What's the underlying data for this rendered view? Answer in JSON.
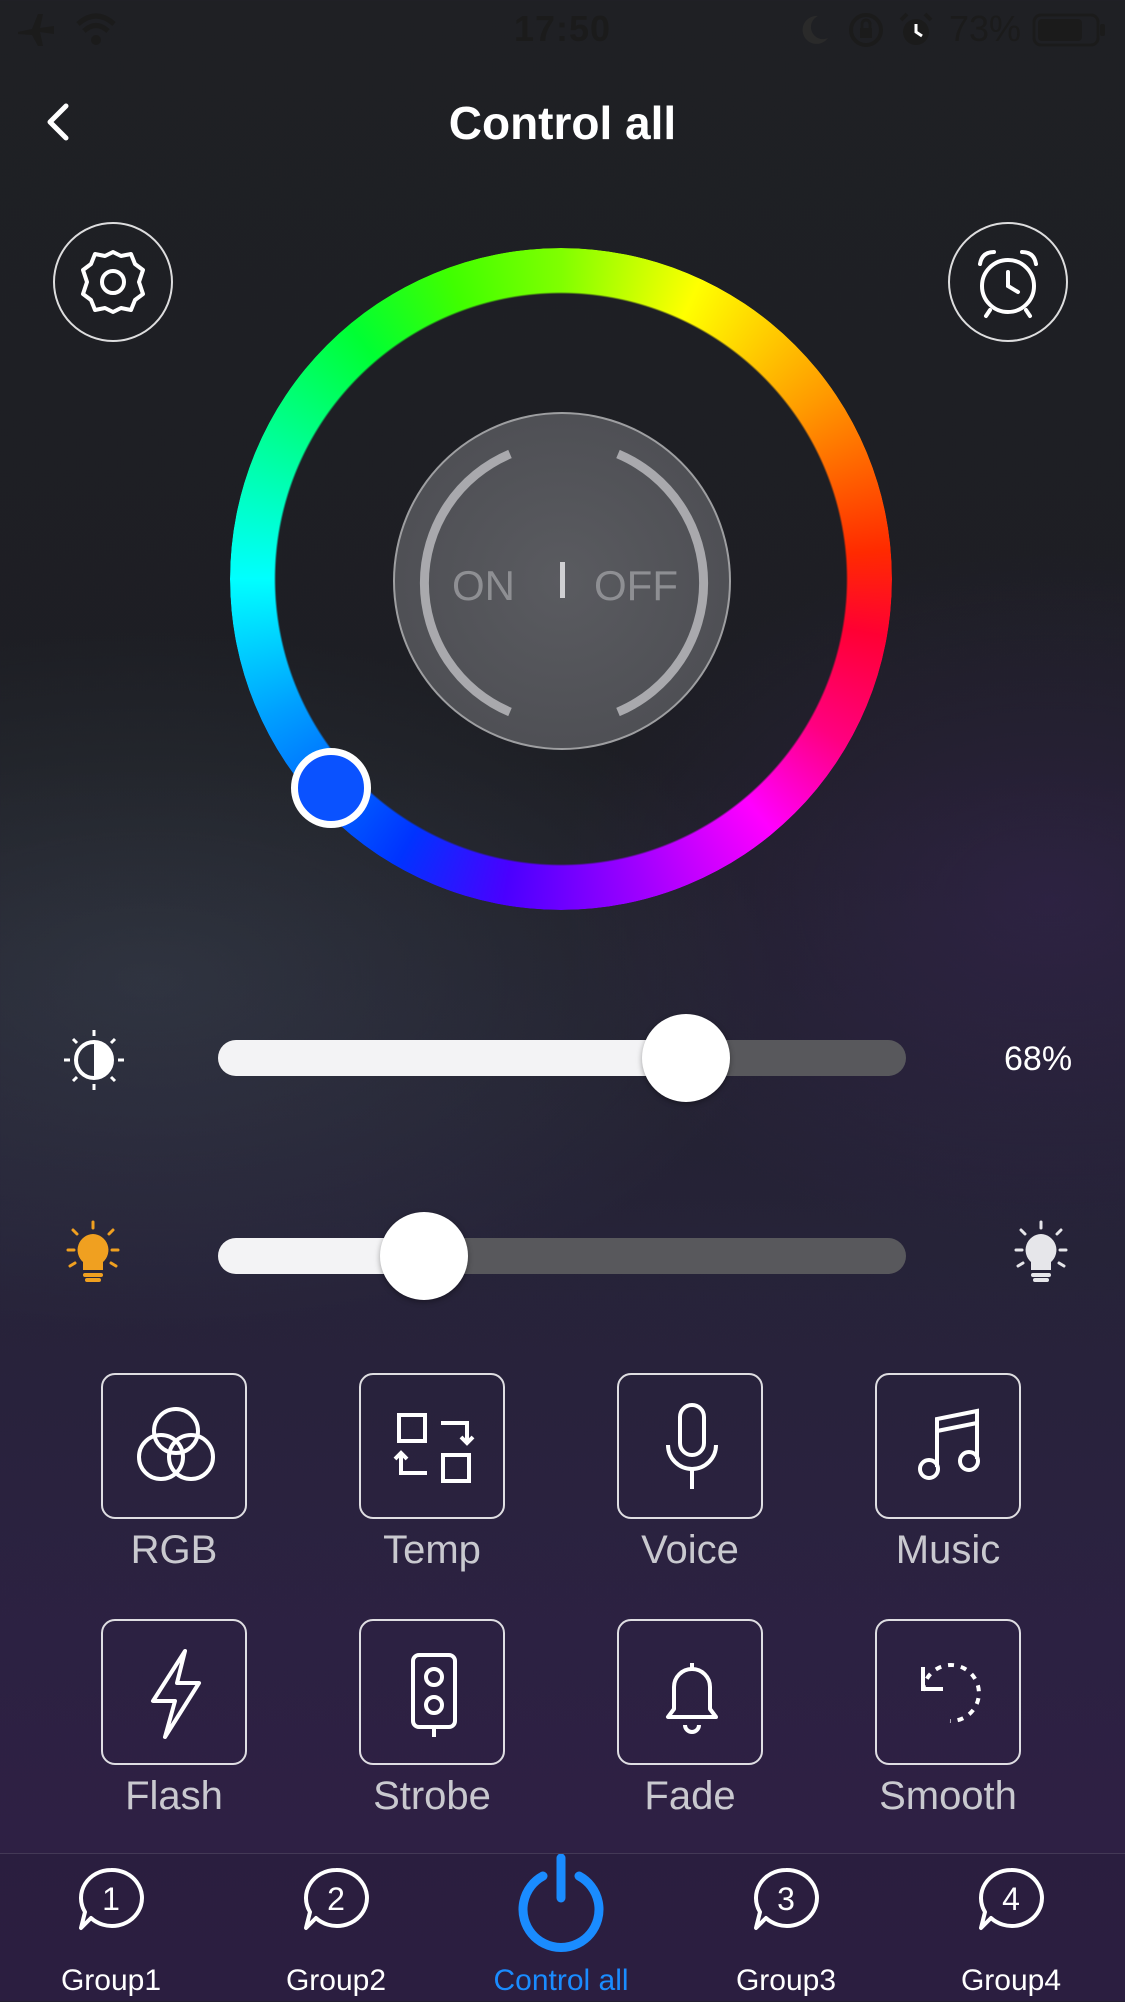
{
  "status_bar": {
    "time": "17:50",
    "battery_percent": "73%"
  },
  "header": {
    "title": "Control all"
  },
  "power_toggle": {
    "on_label": "ON",
    "off_label": "OFF"
  },
  "brightness": {
    "value_text": "68%",
    "level": 0.68
  },
  "temperature": {
    "level": 0.3
  },
  "color_wheel": {
    "selected_color": "#0a52ff"
  },
  "modes": [
    {
      "label": "RGB",
      "icon": "rgb-circles-icon"
    },
    {
      "label": "Temp",
      "icon": "temp-swap-icon"
    },
    {
      "label": "Voice",
      "icon": "microphone-icon"
    },
    {
      "label": "Music",
      "icon": "music-note-icon"
    },
    {
      "label": "Flash",
      "icon": "lightning-icon"
    },
    {
      "label": "Strobe",
      "icon": "strobe-icon"
    },
    {
      "label": "Fade",
      "icon": "bell-icon"
    },
    {
      "label": "Smooth",
      "icon": "rotate-icon"
    }
  ],
  "tabs": [
    {
      "label": "Group1",
      "number": "1"
    },
    {
      "label": "Group2",
      "number": "2"
    },
    {
      "label": "Control all",
      "active": true
    },
    {
      "label": "Group3",
      "number": "3"
    },
    {
      "label": "Group4",
      "number": "4"
    }
  ],
  "colors": {
    "accent": "#1a8cff",
    "knob": "#0a52ff"
  }
}
